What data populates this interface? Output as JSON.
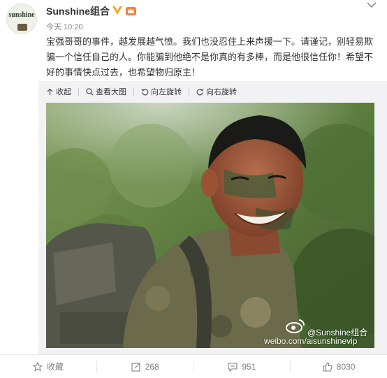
{
  "header": {
    "avatar_text": "sunshine",
    "user_name": "Sunshine组合",
    "timestamp": "今天 10:20",
    "more_icon": "chevron-down-icon"
  },
  "post": {
    "text": "宝强哥哥的事件，越发展越气愤。我们也没忍住上来声援一下。请谨记，别轻易欺骗一个信任自己的人。你能骗到他绝不是你真的有多棒，而是他很信任你！希望不好的事情快点过去，也希望物归原主！"
  },
  "media_toolbar": {
    "collapse": "收起",
    "view_large": "查看大图",
    "rotate_left": "向左旋转",
    "rotate_right": "向右旋转"
  },
  "watermark": {
    "name": "@Sunshine组合",
    "url": "weibo.com/aisunshinevip"
  },
  "footer": {
    "favorite": "收藏",
    "repost_count": "268",
    "comment_count": "951",
    "like_count": "8030"
  },
  "colors": {
    "verified": "#f5a623",
    "vip": "#f2813b",
    "muted_text": "#808080"
  }
}
